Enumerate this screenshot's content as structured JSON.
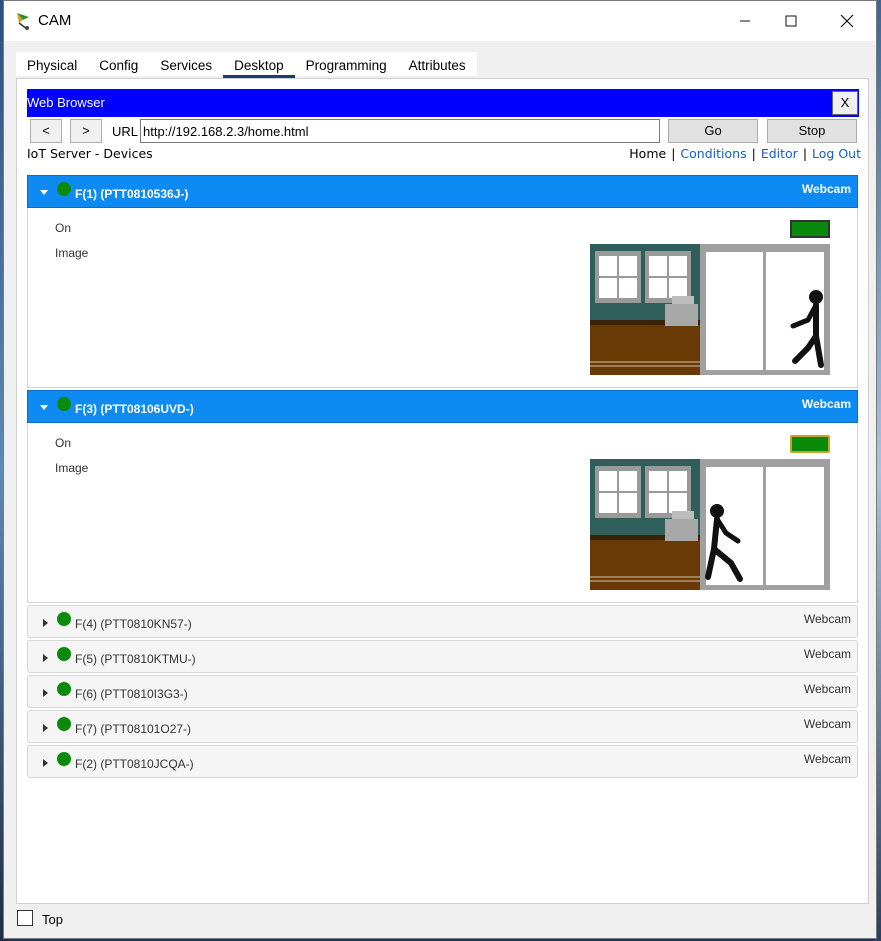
{
  "window": {
    "title": "CAM",
    "minimize": "—",
    "maximize": "☐",
    "close": "✕"
  },
  "tabs": [
    "Physical",
    "Config",
    "Services",
    "Desktop",
    "Programming",
    "Attributes"
  ],
  "active_tab": "Desktop",
  "browser": {
    "title": "Web Browser",
    "close_label": "X",
    "back_label": "<",
    "forward_label": ">",
    "url_label": "URL",
    "url_value": "http://192.168.2.3/home.html",
    "go_label": "Go",
    "stop_label": "Stop"
  },
  "page": {
    "title": "IoT Server - Devices",
    "nav": {
      "home": "Home",
      "conditions": "Conditions",
      "editor": "Editor",
      "logout": "Log Out",
      "separator": "|"
    }
  },
  "devices": [
    {
      "name": "F(1) (PTT0810536J-)",
      "type": "Webcam",
      "expanded": true,
      "status_color": "#0a8a0a",
      "on_label": "On",
      "image_label": "Image",
      "on_state": true
    },
    {
      "name": "F(3) (PTT08106UVD-)",
      "type": "Webcam",
      "expanded": true,
      "status_color": "#0a8a0a",
      "on_label": "On",
      "image_label": "Image",
      "on_state": true
    },
    {
      "name": "F(4) (PTT0810KN57-)",
      "type": "Webcam",
      "expanded": false,
      "status_color": "#0a8a0a"
    },
    {
      "name": "F(5) (PTT0810KTMU-)",
      "type": "Webcam",
      "expanded": false,
      "status_color": "#0a8a0a"
    },
    {
      "name": "F(6) (PTT0810I3G3-)",
      "type": "Webcam",
      "expanded": false,
      "status_color": "#0a8a0a"
    },
    {
      "name": "F(7) (PTT08101O27-)",
      "type": "Webcam",
      "expanded": false,
      "status_color": "#0a8a0a"
    },
    {
      "name": "F(2) (PTT0810JCQA-)",
      "type": "Webcam",
      "expanded": false,
      "status_color": "#0a8a0a"
    }
  ],
  "footer": {
    "top_label": "Top",
    "top_checked": false
  },
  "colors": {
    "browser_header": "#0000ff",
    "device_header_open": "#0d8bf2",
    "status_on": "#0a8a0a"
  }
}
